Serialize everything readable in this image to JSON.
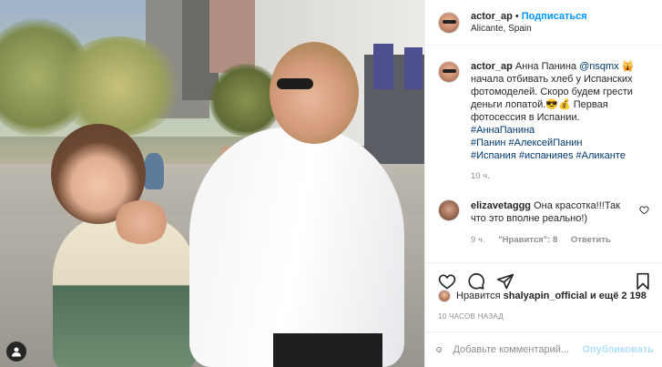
{
  "post": {
    "username": "actor_ap",
    "separator": "•",
    "follow_label": "Подписаться",
    "location": "Alicante, Spain"
  },
  "caption": {
    "username": "actor_ap",
    "text_1": "Анна Панина",
    "mention": "@nsqmx",
    "text_2": "🙀 начала отбивать хлеб у Испанских фотомоделей. Скоро будем грести деньги лопатой.😎💰 Первая фотосессия в Испании.",
    "hashtags": [
      "#АннаПанина",
      "#Панин",
      "#АлексейПанин",
      "#Испания",
      "#испанияes",
      "#Аликанте"
    ],
    "time": "10 ч."
  },
  "comment": {
    "username": "elizavetaggg",
    "text": "Она красотка!!!Так что это вполне реально!)",
    "time": "9 ч.",
    "likes": "\"Нравится\": 8",
    "reply": "Ответить"
  },
  "likes_row": {
    "prefix": "Нравится",
    "user": "shalyapin_official",
    "suffix": "и ещё 2 198"
  },
  "posted_time": "10 ЧАСОВ НАЗАД",
  "add_comment": {
    "placeholder": "Добавьте комментарий...",
    "publish_label": "Опубликовать"
  },
  "colors": {
    "accent": "#0095f6",
    "link": "#00376b",
    "muted": "#8e8e8e",
    "publish_disabled": "#b2dffc"
  },
  "icons": {
    "like": "heart-icon",
    "comment": "comment-icon",
    "share": "paper-plane-icon",
    "save": "bookmark-icon",
    "emoji": "smile-icon",
    "tagged": "user-icon"
  }
}
